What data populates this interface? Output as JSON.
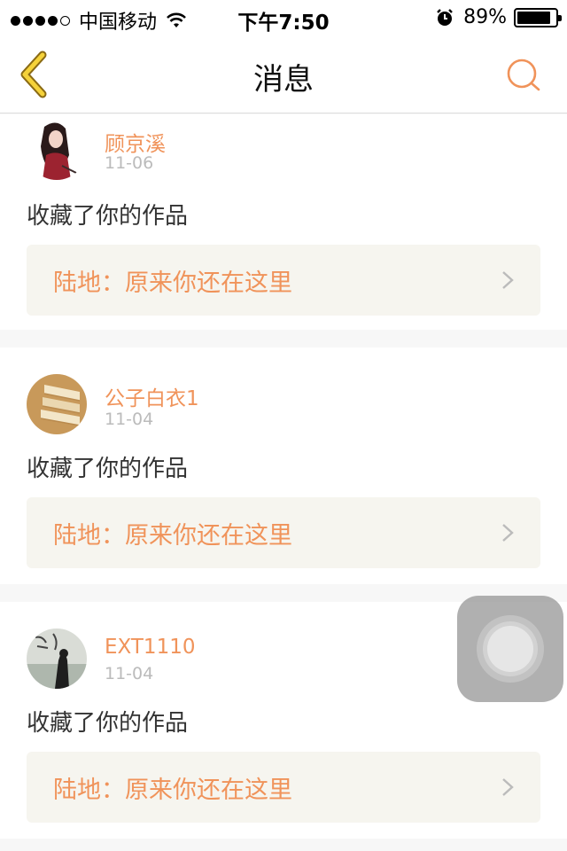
{
  "status_bar": {
    "carrier": "中国移动",
    "time": "下午7:50",
    "battery_percent": "89%",
    "battery_level": 0.89,
    "signal_bars": 4,
    "signal_bars_total": 5
  },
  "nav": {
    "title": "消息",
    "back_icon": "chevron-left-icon",
    "search_icon": "search-icon",
    "accent_color": "#f0935a"
  },
  "messages": [
    {
      "username": "顾京溪",
      "date": "11-06",
      "action": "收藏了你的作品",
      "work_title": "陆地：原来你还在这里",
      "avatar": "girl-portrait"
    },
    {
      "username": "公子白衣1",
      "date": "11-04",
      "action": "收藏了你的作品",
      "work_title": "陆地：原来你还在这里",
      "avatar": "books-stack"
    },
    {
      "username": "EXT1110",
      "date": "11-04",
      "action": "收藏了你的作品",
      "work_title": "陆地：原来你还在这里",
      "avatar": "silhouette-calligraphy"
    }
  ]
}
